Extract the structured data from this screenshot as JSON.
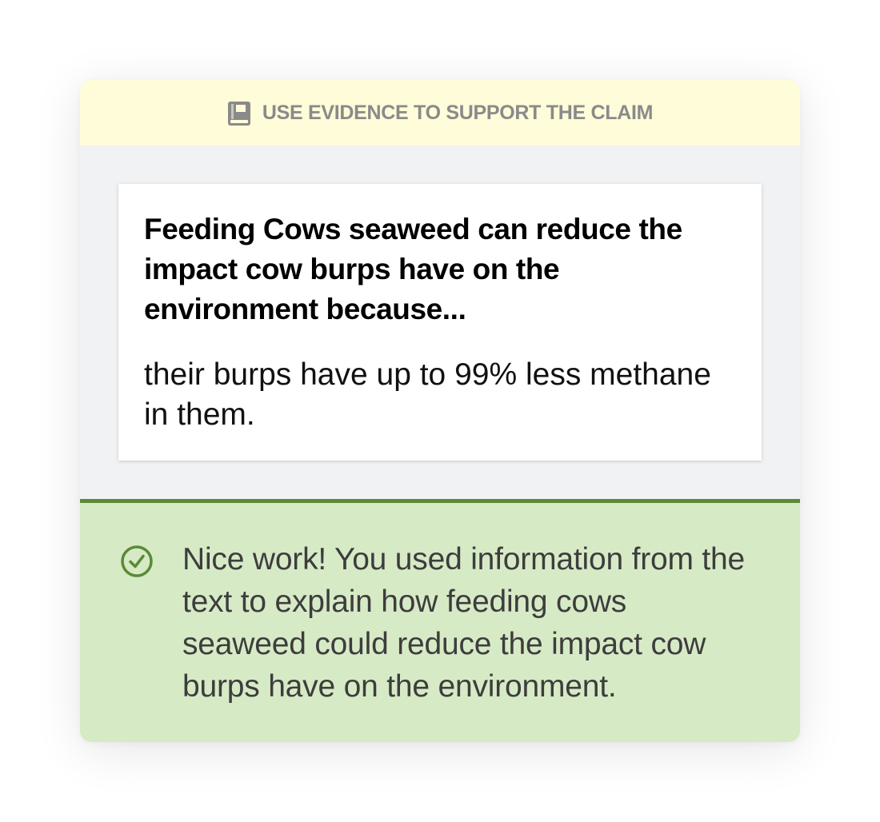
{
  "banner": {
    "icon": "book-icon",
    "text": "USE EVIDENCE TO SUPPORT THE CLAIM"
  },
  "response": {
    "prompt": "Feeding Cows seaweed can reduce the impact cow burps have on the environment because...",
    "answer": "their burps have up to 99% less methane in them."
  },
  "feedback": {
    "icon": "check-circle-icon",
    "text": "Nice work! You used information from the text to explain how feeding cows seaweed could reduce the impact cow burps have on the environment.",
    "accent_color": "#5b8a35",
    "background_color": "#d7eac6"
  },
  "colors": {
    "banner_background": "#fefcd9",
    "card_background": "#f1f2f4"
  }
}
